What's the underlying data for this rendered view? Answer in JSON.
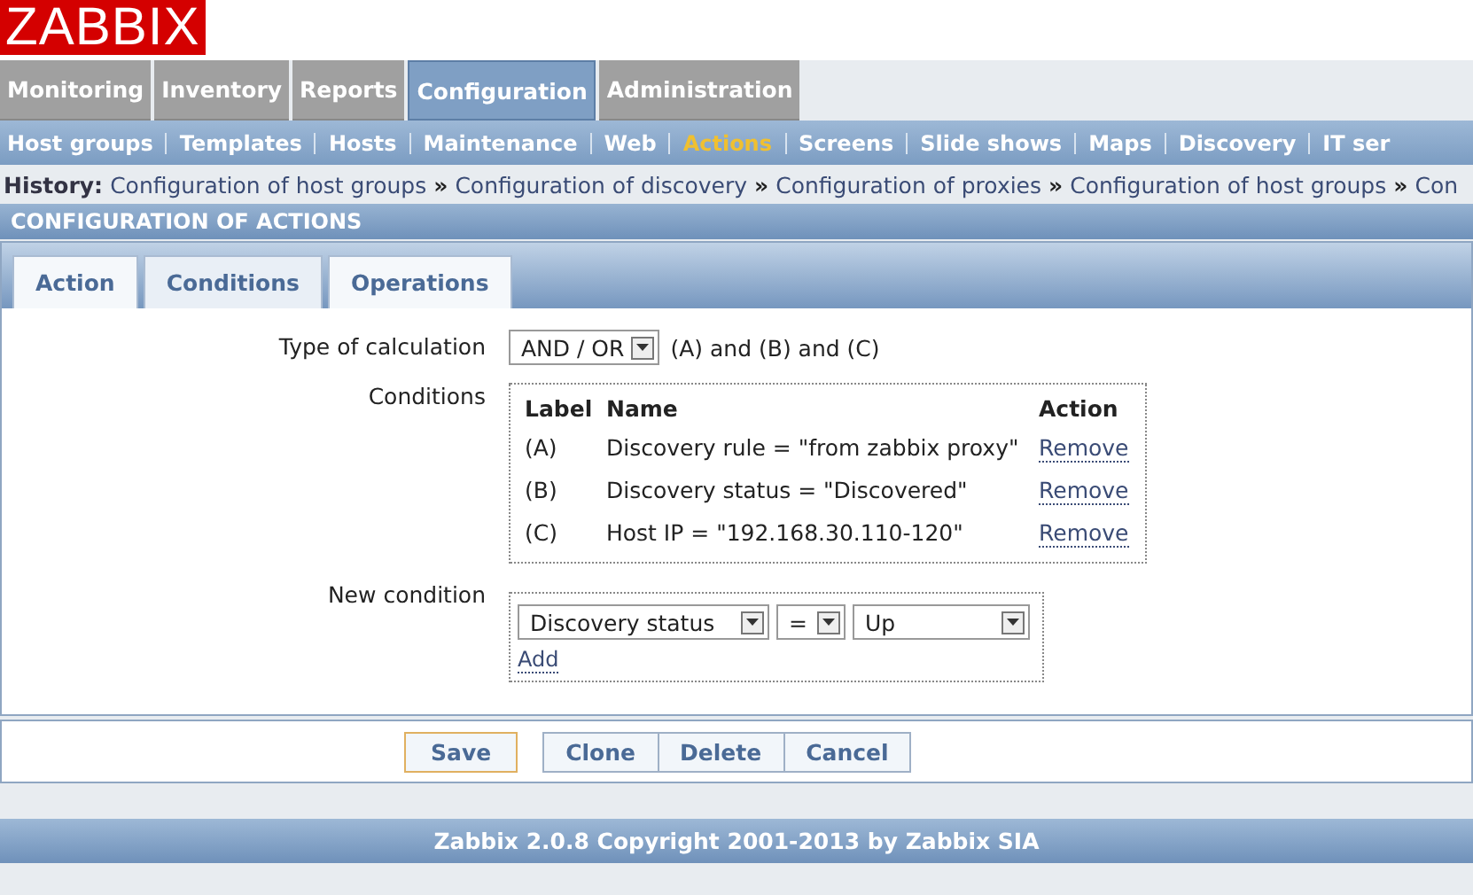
{
  "logo": "ZABBIX",
  "main_menu": [
    {
      "label": "Monitoring",
      "selected": false
    },
    {
      "label": "Inventory",
      "selected": false
    },
    {
      "label": "Reports",
      "selected": false
    },
    {
      "label": "Configuration",
      "selected": true
    },
    {
      "label": "Administration",
      "selected": false
    }
  ],
  "sub_menu": [
    {
      "label": "Host groups",
      "selected": false
    },
    {
      "label": "Templates",
      "selected": false
    },
    {
      "label": "Hosts",
      "selected": false
    },
    {
      "label": "Maintenance",
      "selected": false
    },
    {
      "label": "Web",
      "selected": false
    },
    {
      "label": "Actions",
      "selected": true
    },
    {
      "label": "Screens",
      "selected": false
    },
    {
      "label": "Slide shows",
      "selected": false
    },
    {
      "label": "Maps",
      "selected": false
    },
    {
      "label": "Discovery",
      "selected": false
    },
    {
      "label": "IT ser",
      "selected": false
    }
  ],
  "history": {
    "label": "History:",
    "separator": "»",
    "items": [
      "Configuration of host groups",
      "Configuration of discovery",
      "Configuration of proxies",
      "Configuration of host groups",
      "Con"
    ]
  },
  "section_title": "CONFIGURATION OF ACTIONS",
  "tabs": [
    {
      "label": "Action",
      "selected": false
    },
    {
      "label": "Conditions",
      "selected": true
    },
    {
      "label": "Operations",
      "selected": false
    }
  ],
  "calculation": {
    "label": "Type of calculation",
    "value": "AND / OR",
    "formula": "(A) and (B) and (C)"
  },
  "conditions": {
    "label": "Conditions",
    "columns": [
      "Label",
      "Name",
      "Action"
    ],
    "rows": [
      {
        "label": "(A)",
        "name": "Discovery rule = \"from zabbix proxy\"",
        "action": "Remove"
      },
      {
        "label": "(B)",
        "name": "Discovery status = \"Discovered\"",
        "action": "Remove"
      },
      {
        "label": "(C)",
        "name": "Host IP = \"192.168.30.110-120\"",
        "action": "Remove"
      }
    ]
  },
  "new_condition": {
    "label": "New condition",
    "type": "Discovery status",
    "operator": "=",
    "value": "Up",
    "add": "Add"
  },
  "buttons": [
    {
      "label": "Save",
      "kind": "primary"
    },
    {
      "label": "Clone",
      "kind": "group"
    },
    {
      "label": "Delete",
      "kind": "group"
    },
    {
      "label": "Cancel",
      "kind": "group"
    }
  ],
  "footer": "Zabbix 2.0.8 Copyright 2001-2013 by Zabbix SIA"
}
